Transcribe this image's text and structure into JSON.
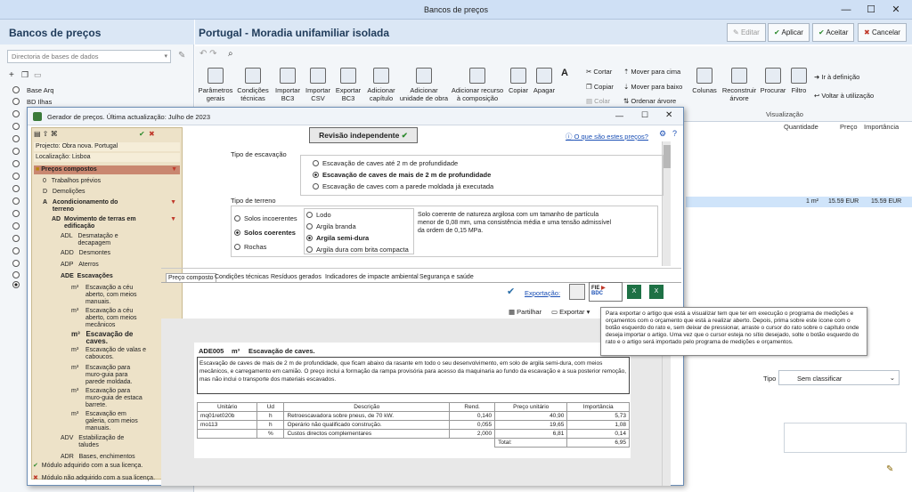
{
  "app": {
    "window_title": "Bancos de preços"
  },
  "left_panel": {
    "title": "Bancos de preços",
    "db_placeholder": "Directoria de bases de dados",
    "items": [
      "Base Arq",
      "BD Ilhas"
    ]
  },
  "main": {
    "title": "Portugal - Moradia unifamiliar isolada",
    "buttons": {
      "edit": "Editar",
      "apply": "Aplicar",
      "accept": "Aceitar",
      "cancel": "Cancelar"
    }
  },
  "ribbon": {
    "large": [
      {
        "label": "Parâmetros gerais"
      },
      {
        "label": "Condições técnicas"
      },
      {
        "label": "Importar BC3"
      },
      {
        "label": "Importar CSV"
      },
      {
        "label": "Exportar BC3"
      },
      {
        "label": "Adicionar capítulo"
      },
      {
        "label": "Adicionar unidade de obra"
      },
      {
        "label": "Adicionar recurso à composição"
      },
      {
        "label": "Copiar"
      },
      {
        "label": "Apagar"
      },
      {
        "label": "Colunas"
      },
      {
        "label": "Reconstruir árvore"
      },
      {
        "label": "Procurar"
      },
      {
        "label": "Filtro"
      }
    ],
    "small": {
      "cut": "Cortar",
      "copy": "Copiar",
      "paste": "Colar",
      "move_up": "Mover para cima",
      "move_down": "Mover para baixo",
      "sort_tree": "Ordenar árvore",
      "goto_def": "Ir à definição",
      "back_to_use": "Voltar à utilização"
    },
    "group_visualizacao": "Visualização"
  },
  "columns": {
    "quantity": "Quantidade",
    "price": "Preço",
    "importance": "Importância"
  },
  "selected_row": {
    "qty": "1 m²",
    "price": "15.59 EUR",
    "importance": "15.59 EUR"
  },
  "tipo": {
    "label": "Tipo",
    "value": "Sem classificar"
  },
  "dialog": {
    "title": "Gerador de preços. Última actualização: Julho de 2023",
    "project": "Projecto: Obra nova. Portugal",
    "location": "Localização: Lisboa",
    "review_button": "Revisão independente",
    "what_link": "O que são estes preços?",
    "tree": [
      {
        "code": "",
        "label": "Preços compostos",
        "level": 0
      },
      {
        "code": "0",
        "label": "Trabalhos prévios",
        "level": 1
      },
      {
        "code": "D",
        "label": "Demolições",
        "level": 1
      },
      {
        "code": "A",
        "label": "Acondicionamento do terreno",
        "level": 1
      },
      {
        "code": "AD",
        "label": "Movimento de terras em edificação",
        "level": 2
      },
      {
        "code": "ADL",
        "label": "Desmatação e decapagem",
        "level": 3
      },
      {
        "code": "ADD",
        "label": "Desmontes",
        "level": 3
      },
      {
        "code": "ADP",
        "label": "Aterros",
        "level": 3
      },
      {
        "code": "ADE",
        "label": "Escavações",
        "level": 3
      },
      {
        "code": "m³",
        "label": "Escavação a céu aberto, com meios manuais.",
        "level": 4
      },
      {
        "code": "m³",
        "label": "Escavação a céu aberto, com meios mecânicos",
        "level": 4
      },
      {
        "code": "m³",
        "label": "Escavação de caves.",
        "level": 4
      },
      {
        "code": "m³",
        "label": "Escavação de valas e caboucos.",
        "level": 4
      },
      {
        "code": "m³",
        "label": "Escavação para muro-guia para parede moldada.",
        "level": 4
      },
      {
        "code": "m³",
        "label": "Escavação para muro-guia de estaca barrete.",
        "level": 4
      },
      {
        "code": "m³",
        "label": "Escavação em galeria, com meios manuais.",
        "level": 4
      },
      {
        "code": "ADV",
        "label": "Estabilização de taludes",
        "level": 3
      },
      {
        "code": "ADR",
        "label": "Bases, enchimentos",
        "level": 3
      }
    ],
    "legend_acquired": "Módulo adquirido com a sua licença.",
    "legend_not_acquired": "Módulo não adquirido com a sua licença.",
    "escavacao": {
      "label": "Tipo de escavação",
      "options": [
        "Escavação de caves até 2 m de profundidade",
        "Escavação de caves de mais de 2 m de profundidade",
        "Escavação de caves com a parede moldada já executada"
      ]
    },
    "terreno": {
      "label": "Tipo de terreno",
      "options": [
        "Solos incoerentes",
        "Solos coerentes",
        "Rochas"
      ],
      "sub_options": [
        "Lodo",
        "Argila branda",
        "Argila semi-dura",
        "Argila dura com brita compacta"
      ],
      "description": "Solo coerente de natureza argilosa com um tamanho de partícula menor de 0,08 mm, uma consistência média e uma tensão admissível da ordem de 0,15 MPa."
    },
    "tabs": [
      "Preço composto",
      "Condições técnicas",
      "Resíduos gerados",
      "Indicadores de impacte ambiental",
      "Segurança e saúde"
    ],
    "export_label": "Exportação:",
    "share": "Partilhar",
    "export_menu": "Exportar",
    "tooltip": "Para exportar o artigo que está a visualizar tem que ter em execução o programa de medições e orçamentos com o orçamento que está a realizar aberto. Depois, prima sobre este ícone com o botão esquerdo do rato e, sem deixar de pressionar, arraste o cursor do rato sobre o capítulo onde deseja importar o artigo. Uma vez que o cursor esteja no sítio desejado, solte o botão esquerdo do rato e o artigo será importado pelo programa de medições e orçamentos.",
    "report": {
      "code": "ADE005",
      "unit": "m³",
      "title": "Escavação de caves.",
      "text": "Escavação de caves de mais de 2 m de profundidade, que ficam abaixo da rasante em todo o seu desenvolvimento, em solo de argila semi-dura, com meios mecânicos, e carregamento em camião. O preço inclui a formação da rampa provisória para acesso da maquinaria ao fundo da escavação e a sua posterior remoção, mas não inclui o transporte dos materiais escavados.",
      "headers": [
        "Unitário",
        "Ud",
        "Descrição",
        "Rend.",
        "Preço unitário",
        "Importância"
      ],
      "rows": [
        [
          "mq01ret020b",
          "h",
          "Retroescavadora sobre pneus, de 70 kW.",
          "0,140",
          "40,90",
          "5,73"
        ],
        [
          "mo113",
          "h",
          "Operário não qualificado construção.",
          "0,055",
          "19,65",
          "1,08"
        ],
        [
          "",
          "%",
          "Custos directos complementares",
          "2,000",
          "6,81",
          "0,14"
        ]
      ],
      "total_label": "Total:",
      "total": "6,95"
    }
  }
}
